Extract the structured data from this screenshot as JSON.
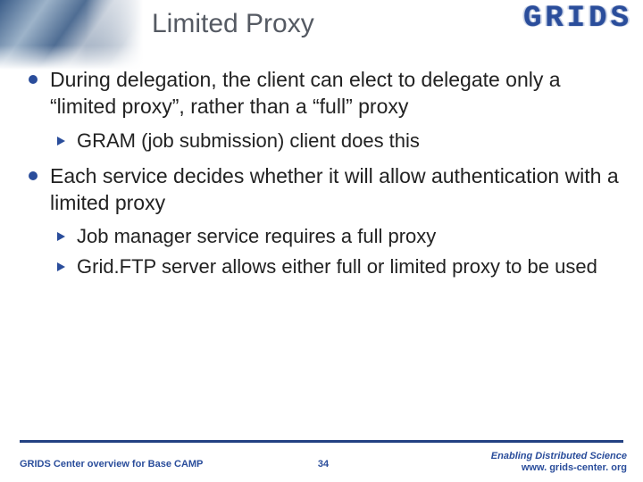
{
  "title": "Limited Proxy",
  "logo": "GRIDS",
  "bullets": {
    "b1": "During delegation, the client can elect to delegate only a “limited proxy”, rather than a “full” proxy",
    "b1_s1": "GRAM (job submission) client does this",
    "b2": "Each service decides whether it will allow authentication with a limited proxy",
    "b2_s1": "Job manager service requires a full proxy",
    "b2_s2": "Grid.FTP server allows either full or limited proxy to be used"
  },
  "footer": {
    "left": "GRIDS Center overview for Base CAMP",
    "page": "34",
    "right1": "Enabling Distributed Science",
    "right2": "www. grids-center. org"
  }
}
